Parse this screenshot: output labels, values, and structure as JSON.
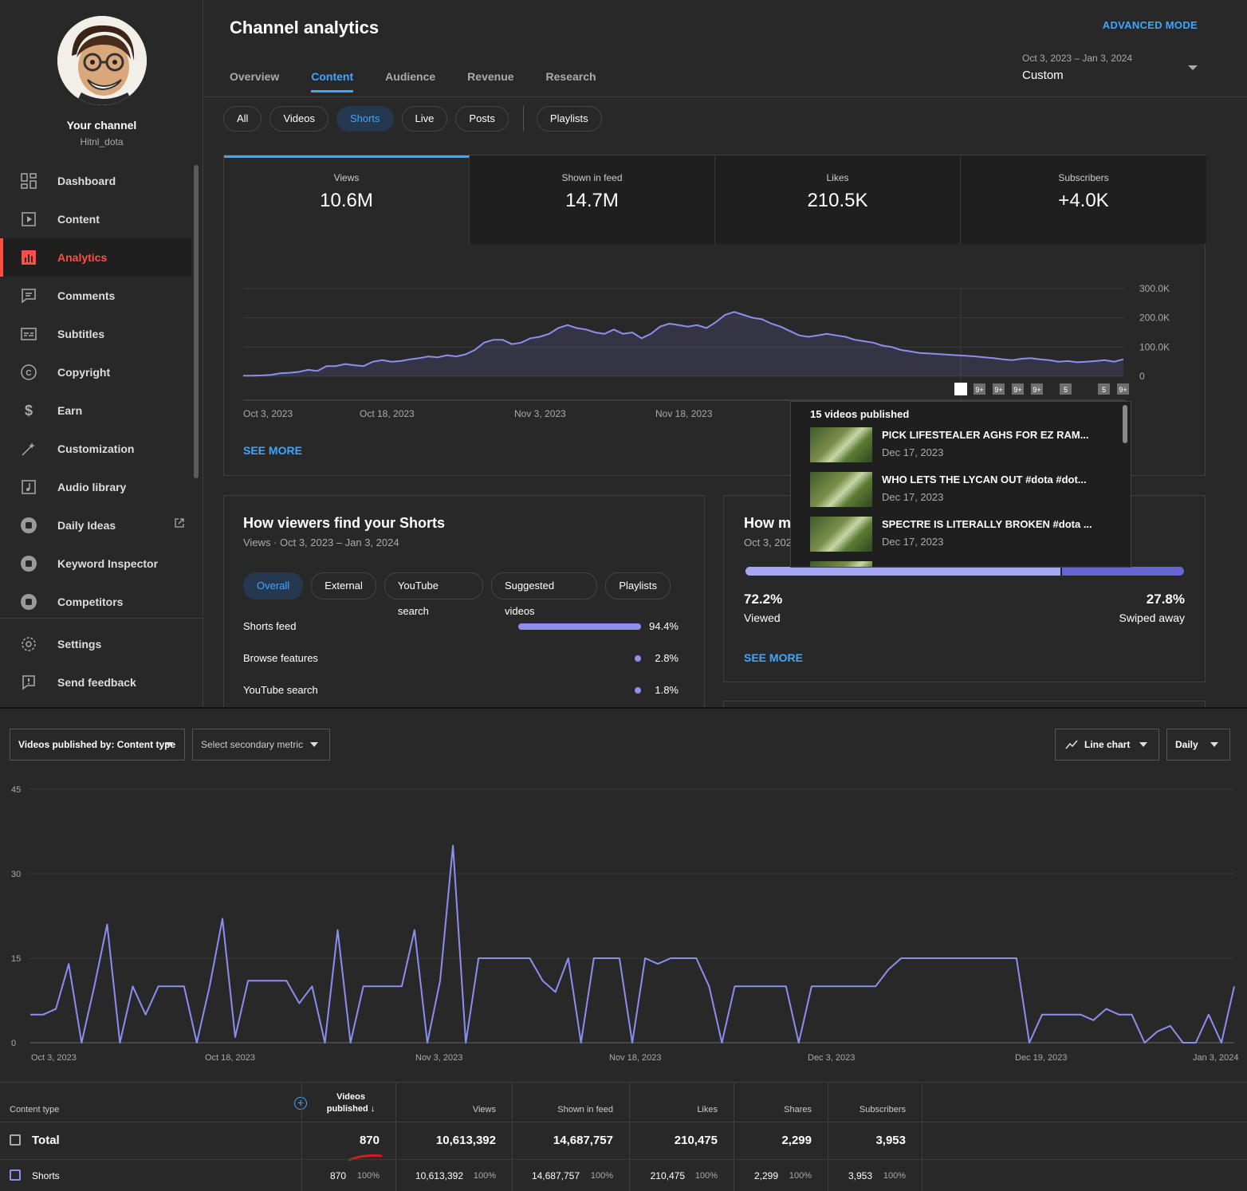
{
  "sidebar": {
    "channel_title": "Your channel",
    "channel_handle": "Hitnl_dota",
    "items": [
      {
        "label": "Dashboard",
        "icon": "dashboard-icon"
      },
      {
        "label": "Content",
        "icon": "content-icon"
      },
      {
        "label": "Analytics",
        "icon": "analytics-icon",
        "active": true
      },
      {
        "label": "Comments",
        "icon": "comments-icon"
      },
      {
        "label": "Subtitles",
        "icon": "subtitles-icon"
      },
      {
        "label": "Copyright",
        "icon": "copyright-icon"
      },
      {
        "label": "Earn",
        "icon": "earn-icon"
      },
      {
        "label": "Customization",
        "icon": "customization-icon"
      },
      {
        "label": "Audio library",
        "icon": "audio-library-icon"
      },
      {
        "label": "Daily Ideas",
        "icon": "vidiq-icon"
      },
      {
        "label": "Keyword Inspector",
        "icon": "vidiq-icon"
      },
      {
        "label": "Competitors",
        "icon": "vidiq-icon"
      }
    ],
    "footer_items": [
      {
        "label": "Settings",
        "icon": "gear-icon"
      },
      {
        "label": "Send feedback",
        "icon": "feedback-icon"
      }
    ]
  },
  "header": {
    "title": "Channel analytics",
    "advanced_mode": "ADVANCED MODE",
    "tabs": [
      "Overview",
      "Content",
      "Audience",
      "Revenue",
      "Research"
    ],
    "active_tab": "Content",
    "date_range": "Oct 3, 2023 – Jan 3, 2024",
    "date_preset": "Custom"
  },
  "content_chips": [
    "All",
    "Videos",
    "Shorts",
    "Live",
    "Posts"
  ],
  "selected_chip": "Shorts",
  "playlists_chip": "Playlists",
  "metrics": [
    {
      "label": "Views",
      "value": "10.6M"
    },
    {
      "label": "Shown in feed",
      "value": "14.7M"
    },
    {
      "label": "Likes",
      "value": "210.5K"
    },
    {
      "label": "Subscribers",
      "value": "+4.0K"
    }
  ],
  "overview_chart": {
    "y_ticks": [
      "300.0K",
      "200.0K",
      "100.0K",
      "0"
    ],
    "x_ticks": [
      "Oct 3, 2023",
      "Oct 18, 2023",
      "Nov 3, 2023",
      "Nov 18, 2023"
    ],
    "markers": [
      "9+",
      "9+",
      "9+",
      "9+",
      "5",
      "5",
      "9+"
    ],
    "see_more": "SEE MORE",
    "series": [
      2,
      2,
      3,
      5,
      10,
      12,
      15,
      22,
      18,
      35,
      35,
      42,
      38,
      35,
      50,
      55,
      50,
      52,
      58,
      62,
      68,
      65,
      72,
      68,
      75,
      90,
      115,
      125,
      125,
      110,
      115,
      130,
      135,
      145,
      165,
      175,
      165,
      160,
      150,
      145,
      160,
      145,
      150,
      130,
      145,
      170,
      180,
      175,
      170,
      175,
      165,
      185,
      210,
      220,
      210,
      200,
      195,
      180,
      170,
      155,
      140,
      135,
      140,
      145,
      140,
      135,
      125,
      120,
      115,
      105,
      100,
      90,
      85,
      80,
      78,
      76,
      74,
      72,
      70,
      68,
      65,
      62,
      58,
      55,
      60,
      62,
      58,
      55,
      50,
      52,
      48,
      50,
      52,
      55,
      50,
      58
    ]
  },
  "popup": {
    "title": "15 videos published",
    "videos": [
      {
        "title": "PICK LIFESTEALER AGHS FOR EZ RAM...",
        "date": "Dec 17, 2023"
      },
      {
        "title": "WHO LETS THE LYCAN OUT #dota #dot...",
        "date": "Dec 17, 2023"
      },
      {
        "title": "SPECTRE IS LITERALLY BROKEN #dota ...",
        "date": "Dec 17, 2023"
      }
    ]
  },
  "traffic_card": {
    "title": "How viewers find your Shorts",
    "subtitle": "Views · Oct 3, 2023 – Jan 3, 2024",
    "chips": [
      "Overall",
      "External",
      "YouTube search",
      "Suggested videos",
      "Playlists"
    ],
    "rows": [
      {
        "name": "Shorts feed",
        "pct": "94.4%",
        "value": 94.4
      },
      {
        "name": "Browse features",
        "pct": "2.8%",
        "value": 2.8
      },
      {
        "name": "YouTube search",
        "pct": "1.8%",
        "value": 1.8
      }
    ]
  },
  "viewed_card": {
    "title": "How ma",
    "subtitle": "Oct 3, 202",
    "viewed_pct": "72.2%",
    "viewed_label": "Viewed",
    "viewed_value": 72.2,
    "swiped_pct": "27.8%",
    "swiped_label": "Swiped away",
    "see_more": "SEE MORE"
  },
  "advanced": {
    "dimension_dropdown": "Videos published by: Content type",
    "secondary_dropdown": "Select secondary metric",
    "chart_type_dropdown": "Line chart",
    "interval_dropdown": "Daily",
    "table": {
      "headers": {
        "content_type": "Content type",
        "videos_published_1": "Videos",
        "videos_published_2": "published",
        "views": "Views",
        "shown_in_feed": "Shown in feed",
        "likes": "Likes",
        "shares": "Shares",
        "subscribers": "Subscribers"
      },
      "total": {
        "label": "Total",
        "videos": "870",
        "views": "10,613,392",
        "shown": "14,687,757",
        "likes": "210,475",
        "shares": "2,299",
        "subs": "3,953"
      },
      "rows": [
        {
          "label": "Shorts",
          "videos": "870",
          "videos_pct": "100%",
          "views": "10,613,392",
          "views_pct": "100%",
          "shown": "14,687,757",
          "shown_pct": "100%",
          "likes": "210,475",
          "likes_pct": "100%",
          "shares": "2,299",
          "shares_pct": "100%",
          "subs": "3,953",
          "subs_pct": "100%"
        }
      ]
    }
  },
  "chart_data": {
    "type": "line",
    "title": "",
    "xlabel": "",
    "ylabel": "",
    "ylim": [
      0,
      45
    ],
    "y_ticks": [
      0,
      15,
      30,
      45
    ],
    "x_ticks": [
      "Oct 3, 2023",
      "Oct 18, 2023",
      "Nov 3, 2023",
      "Nov 18, 2023",
      "Dec 3, 2023",
      "Dec 19, 2023",
      "Jan 3, 2024"
    ],
    "series": [
      {
        "values": [
          5,
          5,
          6,
          14,
          0,
          10,
          21,
          0,
          10,
          5,
          10,
          10,
          10,
          0,
          10,
          22,
          1,
          11,
          11,
          11,
          11,
          7,
          10,
          0,
          20,
          0,
          10,
          10,
          10,
          10,
          20,
          0,
          11,
          35,
          0,
          15,
          15,
          15,
          15,
          15,
          11,
          9,
          15,
          0,
          15,
          15,
          15,
          0,
          15,
          14,
          15,
          15,
          15,
          10,
          0,
          10,
          10,
          10,
          10,
          10,
          0,
          10,
          10,
          10,
          10,
          10,
          10,
          13,
          15,
          15,
          15,
          15,
          15,
          15,
          15,
          15,
          15,
          15,
          0,
          5,
          5,
          5,
          5,
          4,
          6,
          5,
          5,
          0,
          2,
          3,
          0,
          0,
          5,
          0,
          10
        ]
      }
    ]
  }
}
